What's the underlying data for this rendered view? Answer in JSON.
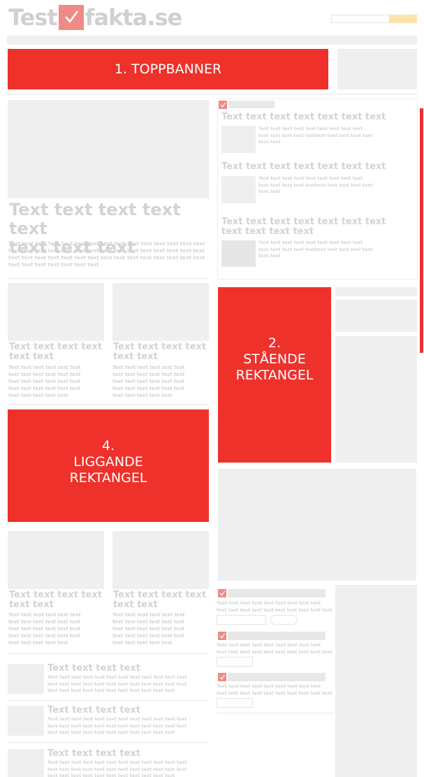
{
  "logo": {
    "left": "Test",
    "right": "fakta.se"
  },
  "banners": {
    "top": "1. TOPPBANNER",
    "standing": [
      "2.",
      "STÅENDE",
      "REKTANGEL"
    ],
    "lying": [
      "4.",
      "LIGGANDE",
      "REKTANGEL"
    ]
  },
  "main_article": {
    "title": "Text text text text text\ntext text text",
    "body": "Text text text text text text text text text text text text text text text text text text text text text text text text text text text text text text text text text text text text text text text text text text text text text text text text text text text text"
  },
  "card": {
    "title": "Text text text text\n text  text",
    "body": "Text text text text text text\n text text text text text text\n text text text text text text\n text text text text text text\n text text text text text"
  },
  "sidebar_news": {
    "title1": "Text text text text text text text",
    "title2": "Text text text text text text text",
    "title3": "Text text text text text text text\n text text text text",
    "body": "Text text text text text text text text text\ntext text text text texttext text text text text\n text text"
  },
  "list_item": {
    "title": "Text text text text",
    "body": "Text text text text text text text text text text text text\ntext text text text text text text text text text text text\ntext text text text text text text text text text text"
  },
  "widget_text": "Text text text text text text text text text\n text text text text text text text text text text",
  "icons": {
    "logo_check": "check-icon"
  },
  "colors": {
    "accent": "#ee312b",
    "check": "#ef8a86",
    "placeholder": "#efefef"
  }
}
